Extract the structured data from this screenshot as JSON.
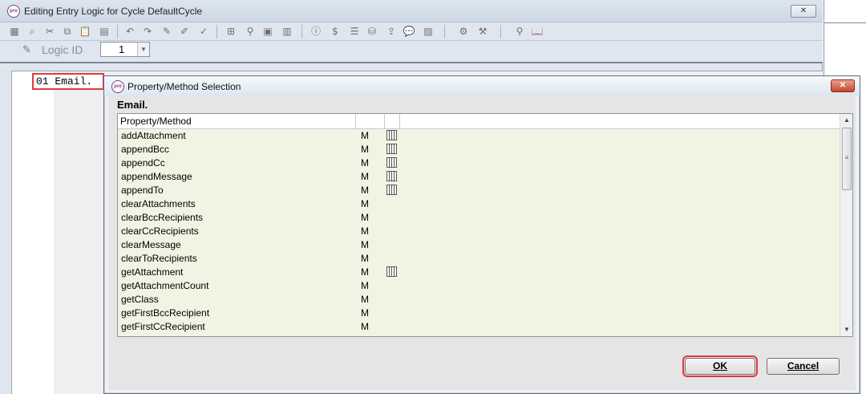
{
  "outer_window": {
    "title": "Editing Entry Logic for Cycle DefaultCycle",
    "close_glyph": "✕"
  },
  "logic_bar": {
    "label": "Logic ID",
    "selected_value": "1"
  },
  "editor": {
    "code_line": "01 Email."
  },
  "dialog": {
    "title": "Property/Method Selection",
    "close_glyph": "✕",
    "object_name": "Email.",
    "columns": [
      "Property/Method",
      "",
      ""
    ],
    "rows": [
      {
        "name": "addAttachment",
        "type": "M",
        "has_params": true
      },
      {
        "name": "appendBcc",
        "type": "M",
        "has_params": true
      },
      {
        "name": "appendCc",
        "type": "M",
        "has_params": true
      },
      {
        "name": "appendMessage",
        "type": "M",
        "has_params": true
      },
      {
        "name": "appendTo",
        "type": "M",
        "has_params": true
      },
      {
        "name": "clearAttachments",
        "type": "M",
        "has_params": false
      },
      {
        "name": "clearBccRecipients",
        "type": "M",
        "has_params": false
      },
      {
        "name": "clearCcRecipients",
        "type": "M",
        "has_params": false
      },
      {
        "name": "clearMessage",
        "type": "M",
        "has_params": false
      },
      {
        "name": "clearToRecipients",
        "type": "M",
        "has_params": false
      },
      {
        "name": "getAttachment",
        "type": "M",
        "has_params": true
      },
      {
        "name": "getAttachmentCount",
        "type": "M",
        "has_params": false
      },
      {
        "name": "getClass",
        "type": "M",
        "has_params": false
      },
      {
        "name": "getFirstBccRecipient",
        "type": "M",
        "has_params": false
      },
      {
        "name": "getFirstCcRecipient",
        "type": "M",
        "has_params": false
      }
    ],
    "ok_label": "OK",
    "cancel_label": "Cancel"
  },
  "colors": {
    "list_background": "#f2f4e3",
    "highlight_border": "#e03a3a"
  }
}
